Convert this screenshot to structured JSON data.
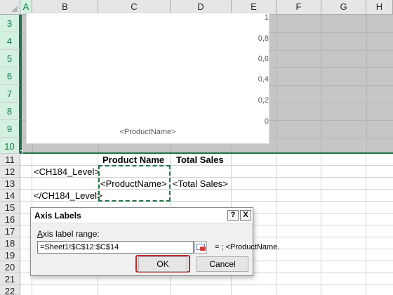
{
  "columns": [
    "A",
    "B",
    "C",
    "D",
    "E",
    "F",
    "G",
    "H"
  ],
  "rows": [
    "3",
    "4",
    "5",
    "6",
    "7",
    "8",
    "9",
    "10",
    "11",
    "12",
    "13",
    "14",
    "15",
    "16",
    "17",
    "18",
    "19",
    "20",
    "21",
    "22"
  ],
  "chart": {
    "y_ticks": [
      "1",
      "0,8",
      "0,6",
      "0,4",
      "0,2",
      "0"
    ],
    "category_label": "<ProductName>"
  },
  "chart_data": {
    "type": "bar",
    "categories": [
      "<ProductName>"
    ],
    "values": [],
    "ylim": [
      0,
      1
    ],
    "grid": false
  },
  "cells": {
    "c11": "Product Name",
    "d11": "Total Sales",
    "b12": "<CH184_Level>",
    "c13": "<ProductName>",
    "d13": "<Total Sales>",
    "b14": "</CH184_Level>"
  },
  "dialog": {
    "title": "Axis Labels",
    "help_button": "?",
    "close_button": "X",
    "field_label_accel": "A",
    "field_label_rest": "xis label range:",
    "range_value": "=Sheet1!$C$12:$C$14",
    "preview": "= ; <ProductName.",
    "ok_label": "OK",
    "cancel_label": "Cancel"
  },
  "colors": {
    "selection_green": "#217346",
    "ok_highlight": "#c0272d"
  }
}
